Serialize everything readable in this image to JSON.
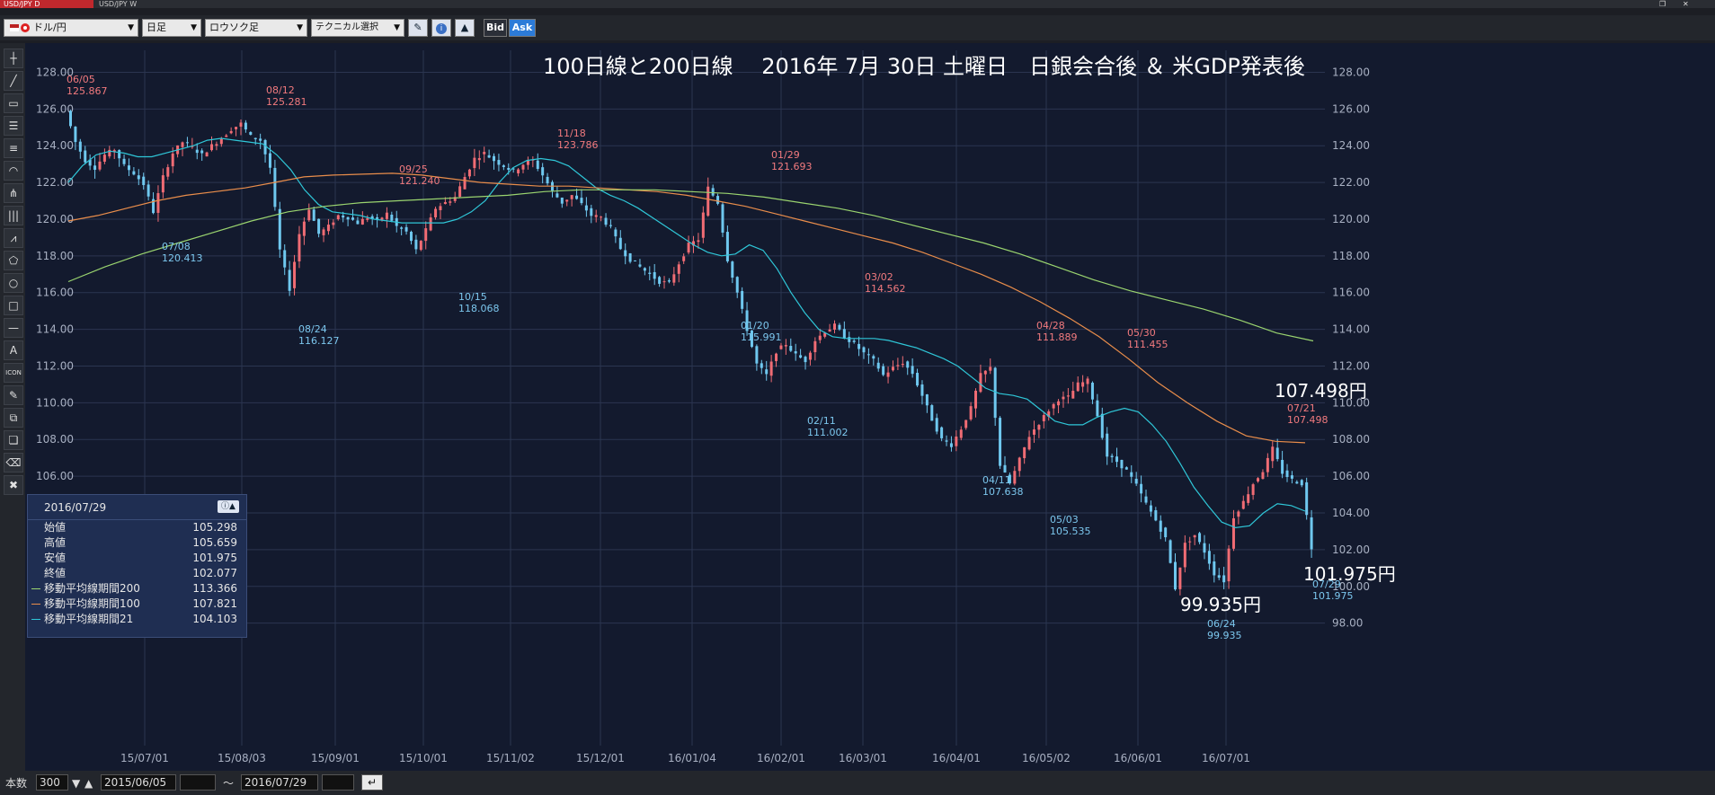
{
  "tabs": [
    {
      "label": "USD/JPY D",
      "active": true
    },
    {
      "label": "USD/JPY W",
      "active": false
    }
  ],
  "toolbar": {
    "currency": "ドル/円",
    "timeframe": "日足",
    "chart_type": "ロウソク足",
    "technical": "テクニカル選択",
    "bid": "Bid",
    "ask": "Ask"
  },
  "sidebar_tools": [
    "crosshair-icon",
    "trendline-icon",
    "ruler-icon",
    "horizontal-lines-icon",
    "channel-icon",
    "fibonacci-arc-icon",
    "pitchfork-icon",
    "vertical-lines-icon",
    "gann-fan-icon",
    "pentagon-icon",
    "circle-icon",
    "rectangle-icon",
    "horizontal-line-icon",
    "text-icon",
    "icon-stamp-icon",
    "pen-icon",
    "copy-icon",
    "clone-icon",
    "eraser-icon",
    "delete-icon"
  ],
  "sidebar_labels": {
    "text_tool": "A",
    "icon_tool": "ICON"
  },
  "chart": {
    "title": "100日線と200日線　 2016年 7月 30日 土曜日　日銀会合後 ＆ 米GDP発表後",
    "y_ticks": [
      "128.00",
      "126.00",
      "124.00",
      "122.00",
      "120.00",
      "118.00",
      "116.00",
      "114.00",
      "112.00",
      "110.00",
      "108.00",
      "106.00",
      "104.00",
      "102.00",
      "100.00",
      "98.00"
    ],
    "x_ticks": [
      "15/07/01",
      "15/08/03",
      "15/09/01",
      "15/10/01",
      "15/11/02",
      "15/12/01",
      "16/01/04",
      "16/02/01",
      "16/03/01",
      "16/04/01",
      "16/05/02",
      "16/06/01",
      "16/07/01"
    ],
    "big_labels": {
      "high": "107.498円",
      "close": "101.975円",
      "low": "99.935円"
    }
  },
  "chart_data": {
    "type": "candlestick",
    "y_range": [
      97.2,
      129.0
    ],
    "x_ticks": [
      "15/07/01",
      "15/08/03",
      "15/09/01",
      "15/10/01",
      "15/11/02",
      "15/12/01",
      "16/01/04",
      "16/02/01",
      "16/03/01",
      "16/04/01",
      "16/05/02",
      "16/06/01",
      "16/07/01"
    ],
    "annotations": [
      {
        "date": "06/05",
        "value": "125.867",
        "kind": "high"
      },
      {
        "date": "07/08",
        "value": "120.413",
        "kind": "low"
      },
      {
        "date": "08/12",
        "value": "125.281",
        "kind": "high"
      },
      {
        "date": "08/24",
        "value": "116.127",
        "kind": "low"
      },
      {
        "date": "09/25",
        "value": "121.240",
        "kind": "high"
      },
      {
        "date": "10/15",
        "value": "118.068",
        "kind": "low"
      },
      {
        "date": "11/18",
        "value": "123.786",
        "kind": "high"
      },
      {
        "date": "01/29",
        "value": "121.693",
        "kind": "high"
      },
      {
        "date": "01/20",
        "value": "115.991",
        "kind": "low"
      },
      {
        "date": "02/11",
        "value": "111.002",
        "kind": "low"
      },
      {
        "date": "03/02",
        "value": "114.562",
        "kind": "high"
      },
      {
        "date": "04/28",
        "value": "111.889",
        "kind": "high"
      },
      {
        "date": "04/11",
        "value": "107.638",
        "kind": "low"
      },
      {
        "date": "05/03",
        "value": "105.535",
        "kind": "low"
      },
      {
        "date": "05/30",
        "value": "111.455",
        "kind": "high"
      },
      {
        "date": "06/24",
        "value": "99.935",
        "kind": "low"
      },
      {
        "date": "07/21",
        "value": "107.498",
        "kind": "high"
      },
      {
        "date": "07/29",
        "value": "101.975",
        "kind": "low"
      }
    ],
    "candle_path": [
      125.9,
      124.2,
      123.2,
      122.8,
      123.5,
      123.8,
      122.9,
      122.5,
      121.9,
      120.4,
      122.3,
      123.6,
      124.2,
      123.9,
      123.5,
      124.0,
      124.4,
      124.9,
      125.2,
      124.5,
      124.3,
      122.8,
      118.3,
      116.2,
      119.2,
      120.6,
      119.2,
      119.6,
      120.2,
      120.1,
      119.8,
      120.1,
      119.9,
      120.3,
      119.6,
      119.3,
      118.3,
      119.4,
      120.6,
      120.9,
      121.2,
      122.3,
      123.3,
      123.6,
      123.2,
      122.9,
      122.6,
      123.0,
      123.2,
      122.4,
      121.5,
      120.9,
      121.3,
      120.8,
      120.2,
      120.1,
      119.5,
      118.4,
      117.8,
      117.4,
      117.0,
      116.6,
      116.5,
      117.6,
      118.6,
      118.9,
      121.7,
      120.9,
      117.8,
      116.0,
      114.0,
      112.1,
      111.5,
      112.8,
      113.2,
      112.6,
      112.3,
      113.4,
      113.9,
      114.2,
      113.6,
      113.2,
      112.7,
      112.3,
      111.5,
      111.9,
      112.2,
      111.6,
      110.4,
      109.1,
      108.0,
      107.7,
      108.6,
      109.7,
      111.5,
      111.9,
      106.6,
      105.6,
      106.9,
      108.2,
      108.9,
      109.6,
      110.2,
      110.3,
      111.0,
      111.2,
      109.3,
      107.1,
      106.8,
      106.3,
      105.5,
      104.5,
      103.6,
      102.6,
      99.9,
      102.3,
      102.8,
      101.9,
      100.7,
      100.3,
      103.8,
      104.6,
      105.6,
      106.3,
      107.5,
      106.2,
      105.8,
      105.6,
      102.1
    ],
    "series": [
      {
        "name": "移動平均線期間21",
        "color": "#2fc7d8",
        "values": [
          122.0,
          122.9,
          123.5,
          123.7,
          123.6,
          123.4,
          123.4,
          123.6,
          123.8,
          124.0,
          124.3,
          124.4,
          124.3,
          124.2,
          124.1,
          123.5,
          122.7,
          121.6,
          120.8,
          120.4,
          120.3,
          120.2,
          120.0,
          119.9,
          119.8,
          119.8,
          119.8,
          119.8,
          120.0,
          120.4,
          121.0,
          122.0,
          122.8,
          123.2,
          123.3,
          123.2,
          122.9,
          122.3,
          121.7,
          121.3,
          121.0,
          120.6,
          120.1,
          119.6,
          119.1,
          118.6,
          118.2,
          118.0,
          118.1,
          118.6,
          118.3,
          117.3,
          116.0,
          114.9,
          114.0,
          113.6,
          113.5,
          113.5,
          113.5,
          113.4,
          113.2,
          113.0,
          112.7,
          112.4,
          112.0,
          111.4,
          110.8,
          110.5,
          110.4,
          110.2,
          109.6,
          109.0,
          108.8,
          108.8,
          109.2,
          109.5,
          109.7,
          109.5,
          108.8,
          107.9,
          106.7,
          105.4,
          104.4,
          103.5,
          103.2,
          103.3,
          104.0,
          104.5,
          104.4,
          104.1
        ]
      },
      {
        "name": "移動平均線期間100",
        "color": "#e98d4b",
        "values": [
          119.9,
          120.2,
          120.6,
          121.0,
          121.3,
          121.5,
          121.7,
          122.0,
          122.3,
          122.4,
          122.45,
          122.5,
          122.4,
          122.2,
          122.0,
          121.9,
          121.8,
          121.8,
          121.7,
          121.6,
          121.5,
          121.3,
          121.0,
          120.7,
          120.3,
          119.9,
          119.5,
          119.1,
          118.7,
          118.2,
          117.6,
          117.0,
          116.3,
          115.5,
          114.6,
          113.6,
          112.4,
          111.1,
          110.0,
          109.0,
          108.2,
          107.9,
          107.82
        ]
      },
      {
        "name": "移動平均線期間200",
        "color": "#9ad46f",
        "values": [
          116.6,
          117.4,
          118.1,
          118.7,
          119.3,
          119.9,
          120.4,
          120.7,
          120.9,
          121.0,
          121.1,
          121.2,
          121.3,
          121.5,
          121.6,
          121.6,
          121.6,
          121.5,
          121.4,
          121.2,
          120.9,
          120.6,
          120.2,
          119.7,
          119.2,
          118.7,
          118.1,
          117.4,
          116.7,
          116.1,
          115.6,
          115.1,
          114.5,
          113.8,
          113.37
        ]
      }
    ]
  },
  "info_panel": {
    "date": "2016/07/29",
    "rows": [
      {
        "label": "始値",
        "value": "105.298",
        "color": ""
      },
      {
        "label": "高値",
        "value": "105.659",
        "color": ""
      },
      {
        "label": "安値",
        "value": "101.975",
        "color": ""
      },
      {
        "label": "終値",
        "value": "102.077",
        "color": ""
      },
      {
        "label": "移動平均線期間200",
        "value": "113.366",
        "color": "#9ad46f"
      },
      {
        "label": "移動平均線期間100",
        "value": "107.821",
        "color": "#e98d4b"
      },
      {
        "label": "移動平均線期間21",
        "value": "104.103",
        "color": "#2fc7d8"
      }
    ]
  },
  "statusbar": {
    "count_label": "本数",
    "count": "300",
    "from": "2015/06/05",
    "tilde": "〜",
    "to": "2016/07/29"
  }
}
